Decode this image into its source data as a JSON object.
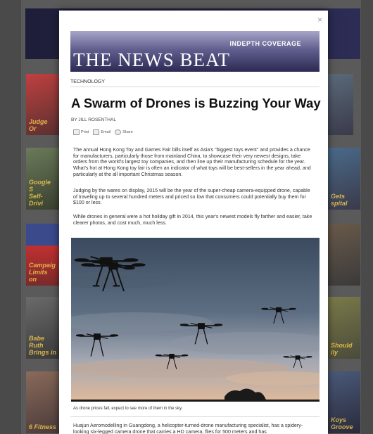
{
  "background": {
    "tiles": [
      {
        "caption": "Judge Or"
      },
      {
        "caption": "Google S\nSelf-Drivi"
      },
      {
        "caption": "Campaig\nLimits on"
      },
      {
        "caption": "Babe Ruth\nBrings in"
      },
      {
        "caption": "6 Fitness"
      },
      {
        "caption": "Gets\nspital"
      },
      {
        "caption": "Should\nily"
      },
      {
        "caption": "Koys\nGroove"
      }
    ]
  },
  "modal": {
    "close_label": "×",
    "banner": {
      "subtitle": "INDEPTH COVERAGE",
      "title": "THE NEWS BEAT"
    },
    "section": "TECHNOLOGY",
    "headline": "A Swarm of Drones is Buzzing Your Way",
    "byline": "BY JILL ROSENTHAL",
    "share": {
      "print": "Print",
      "email": "Email",
      "share": "Share"
    },
    "paragraphs": [
      "The annual Hong Kong Toy and Games Fair bills itself as Asia's \"biggest toys event\" and provides a chance for manufacturers, particularly those from mainland China, to showcase their very newest designs, take orders from the world's largest toy companies, and then line up their manufacturing schedule for the year. What's hot at Hong Kong toy fair is often an indicator of what toys will be best-sellers in the year ahead, and particularly at the all important Christmas season.",
      "Judging by the wares on display, 2015 will be the year of the super-cheap camera-equipped drone, capable of traveling up to several hundred meters and priced so low that consumers could potentially buy them for $100 or less.",
      "While drones in general were a hot holiday gift in 2014, this year's newest models fly farther and easier, take clearer photos, and cost much, much less."
    ],
    "photo_caption": "As drone prices fall, expect to see more of them in the sky.",
    "after_photo": "Huajun Aeromodelling in Guangdong, a helicopter-turned-drone manufacturing specialist, has a spidery-looking six-legged camera drone that carries a HD camera, flies for 500 meters and has"
  }
}
